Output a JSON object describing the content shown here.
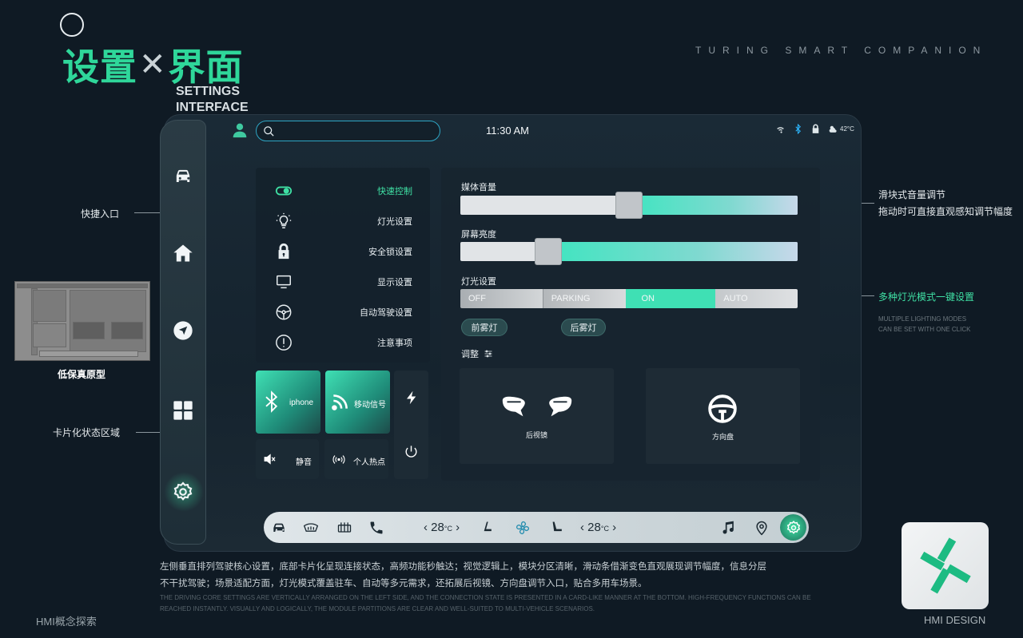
{
  "header": {
    "title_cn_left": "设置",
    "title_cn_x": "✕",
    "title_cn_right": "界面",
    "title_en_line1": "SETTINGS",
    "title_en_line2": "INTERFACE",
    "brand": "TURING SMART COMPANION"
  },
  "annotations": {
    "quick_entry": "快捷入口",
    "prototype_label": "低保真原型",
    "card_area": "卡片化状态区域",
    "slider_line1": "滑块式音量调节",
    "slider_line2": "拖动时可直接直观感知调节幅度",
    "lighting_cn": "多种灯光模式一键设置",
    "lighting_en1": "MULTIPLE LIGHTING MODES",
    "lighting_en2": "CAN BE SET WITH ONE CLICK"
  },
  "status": {
    "time": "11:30 AM",
    "temperature": "42°C"
  },
  "search": {
    "placeholder": ""
  },
  "sidebar": {
    "items": [
      {
        "icon": "car-icon"
      },
      {
        "icon": "home-icon"
      },
      {
        "icon": "navigation-icon"
      },
      {
        "icon": "apps-grid-icon"
      },
      {
        "icon": "settings-gear-icon",
        "active": true
      }
    ]
  },
  "menu": {
    "items": [
      {
        "label": "快速控制",
        "icon": "toggle-icon",
        "active": true
      },
      {
        "label": "灯光设置",
        "icon": "bulb-icon"
      },
      {
        "label": "安全锁设置",
        "icon": "lock-icon"
      },
      {
        "label": "显示设置",
        "icon": "monitor-icon"
      },
      {
        "label": "自动驾驶设置",
        "icon": "steering-wheel-icon"
      },
      {
        "label": "注意事项",
        "icon": "alert-icon"
      }
    ]
  },
  "cards": {
    "bluetooth": "iphone",
    "signal": "移动信号",
    "mute": "静音",
    "hotspot": "个人热点"
  },
  "settings": {
    "media_volume_label": "媒体音量",
    "media_volume_level": 0.5,
    "brightness_label": "屏幕亮度",
    "brightness_level": 0.26,
    "lighting_label": "灯光设置",
    "lighting_modes": [
      "OFF",
      "PARKING",
      "ON",
      "AUTO"
    ],
    "lighting_selected": "ON",
    "front_fog": "前雾灯",
    "rear_fog": "后雾灯",
    "adjust_label": "调整",
    "mirror_label": "后视镜",
    "wheel_label": "方向盘"
  },
  "dock": {
    "left_temp": "28",
    "right_temp": "28",
    "unit": "°C"
  },
  "description": {
    "cn": "左侧垂直排列驾驶核心设置，底部卡片化呈现连接状态，高频功能秒触达；视觉逻辑上，模块分区清晰，滑动条借渐变色直观展现调节幅度，信息分层不干扰驾驶；场景适配方面，灯光模式覆盖驻车、自动等多元需求，还拓展后视镜、方向盘调节入口，贴合多用车场景。",
    "en": "THE DRIVING CORE SETTINGS ARE VERTICALLY ARRANGED ON THE LEFT SIDE, AND THE CONNECTION STATE IS PRESENTED IN A CARD-LIKE MANNER AT THE BOTTOM. HIGH-FREQUENCY FUNCTIONS CAN BE REACHED INSTANTLY. VISUALLY AND LOGICALLY, THE MODULE PARTITIONS ARE CLEAR AND WELL-SUITED TO MULTI-VEHICLE SCENARIOS."
  },
  "footer": {
    "left": "HMI概念探索",
    "right": "HMI DESIGN"
  },
  "colors": {
    "accent": "#3fe0a4",
    "background": "#0f1a24"
  }
}
